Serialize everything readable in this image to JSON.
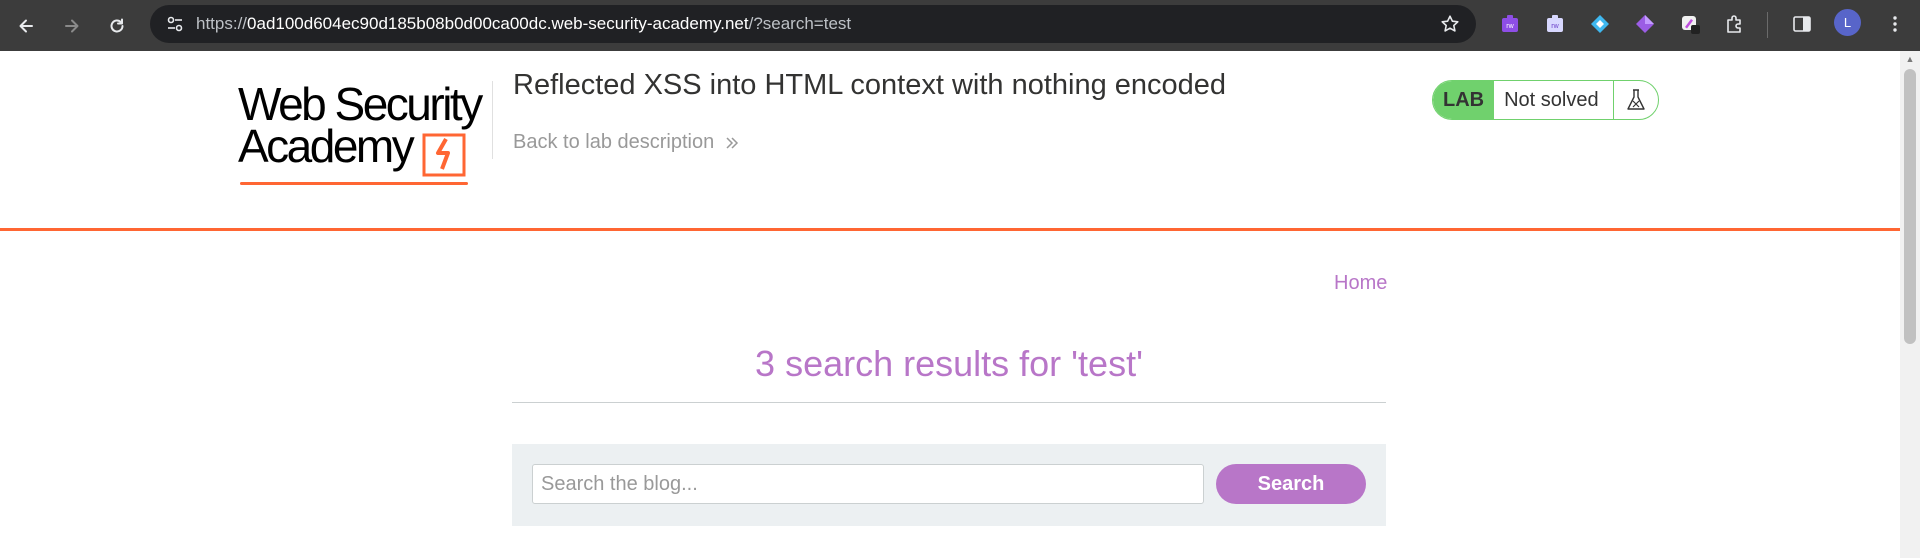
{
  "browser": {
    "url_prefix": "https://",
    "url_host": "0ad100d604ec90d185b08b0d00ca00dc.web-security-academy.net",
    "url_path": "/?search=test",
    "avatar_letter": "L",
    "extensions": [
      "rw-extension-icon",
      "rw-vue-extension-icon",
      "diamond-blue-extension-icon",
      "diamond-purple-extension-icon",
      "pen-extension-icon",
      "puzzle-icon"
    ]
  },
  "header": {
    "logo_line1": "Web Security",
    "logo_line2": "Academy",
    "lab_title": "Reflected XSS into HTML context with nothing encoded",
    "back_link": "Back to lab description",
    "lab_badge_label": "LAB",
    "lab_status": "Not solved",
    "colors": {
      "accent": "#ff6633",
      "lab_green": "#70d16d",
      "link_purple": "#b876c8"
    }
  },
  "nav": {
    "home": "Home"
  },
  "main": {
    "results_heading": "3 search results for 'test'",
    "search_placeholder": "Search the blog...",
    "search_button": "Search"
  }
}
